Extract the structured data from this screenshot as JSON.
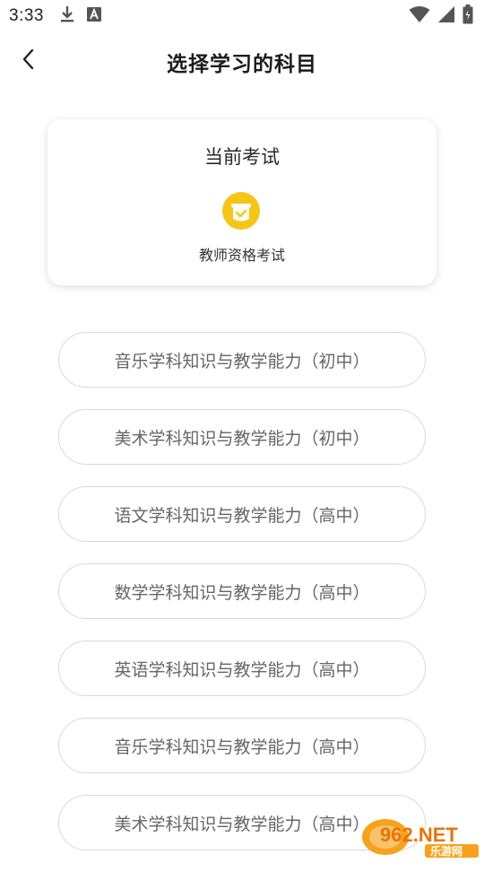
{
  "status_bar": {
    "time": "3:33",
    "icons": [
      "download-icon",
      "text-a-icon",
      "wifi-icon",
      "signal-icon",
      "battery-icon"
    ]
  },
  "header": {
    "title": "选择学习的科目"
  },
  "current_exam": {
    "title": "当前考试",
    "exam_name": "教师资格考试",
    "icon": "exam-badge-icon",
    "icon_color": "#F5C518"
  },
  "subjects": [
    {
      "label": "音乐学科知识与教学能力（初中）"
    },
    {
      "label": "美术学科知识与教学能力（初中）"
    },
    {
      "label": "语文学科知识与教学能力（高中）"
    },
    {
      "label": "数学学科知识与教学能力（高中）"
    },
    {
      "label": "英语学科知识与教学能力（高中）"
    },
    {
      "label": "音乐学科知识与教学能力（高中）"
    },
    {
      "label": "美术学科知识与教学能力（高中）"
    }
  ],
  "watermark": {
    "brand_top": "962.NET",
    "brand_bottom": "乐游网"
  }
}
